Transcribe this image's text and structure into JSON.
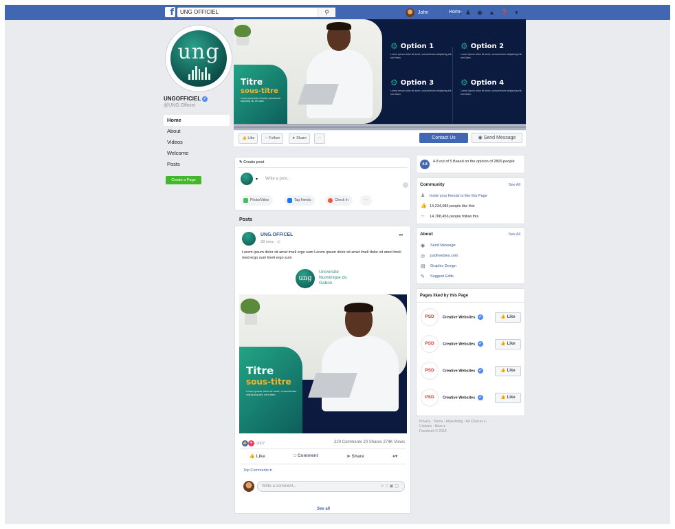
{
  "topbar": {
    "logo": "f",
    "search_value": "UNG OFFICIEL",
    "search_icon": "search-icon",
    "user_name": "John",
    "home_label": "Home",
    "icons": [
      "friends-icon",
      "messenger-icon",
      "notifications-icon",
      "help-icon",
      "caret-down-icon"
    ]
  },
  "profile": {
    "logo_text": "ung",
    "name": "UNGOFFICIEL",
    "handle": "@UNG.Officiel",
    "nav": [
      "Home",
      "About",
      "Videos",
      "Welcome",
      "Posts"
    ],
    "create_page": "Create a Page"
  },
  "cover": {
    "titre": "Titre",
    "sous_titre": "sous-titre",
    "lorem": "Lorem ipsum dolor sit amet, consectetuer adipiscing elit, sed diam.",
    "options": [
      {
        "title": "Option 1",
        "desc": "Lorem ipsum dolor sit amet, consectetuer adipiscing elit, sed diam."
      },
      {
        "title": "Option 2",
        "desc": "Lorem ipsum dolor sit amet, consectetuer adipiscing elit, sed diam."
      },
      {
        "title": "Option 3",
        "desc": "Lorem ipsum dolor sit amet, consectetuer adipiscing elit, sed diam."
      },
      {
        "title": "Option 4",
        "desc": "Lorem ipsum dolor sit amet, consectetuer adipiscing elit, sed diam."
      }
    ]
  },
  "actions": {
    "like": "Like",
    "follow": "Follow",
    "share": "Share",
    "more": "···",
    "contact": "Contact Us",
    "send_message": "Send Message"
  },
  "create_post": {
    "header": "Create post",
    "placeholder": "Write a post...",
    "buttons": [
      "Photo/Video",
      "Tag friends",
      "Check In",
      "···"
    ]
  },
  "posts": {
    "label": "Posts",
    "author": "UNG.OFFICEL",
    "time": "38 mins ·",
    "text": "Lorem ipsum dolor sit amet lmeli ergo sum Lorem ipsum dolor sit amet lmeli dolor sit amet lmeli med ergo sum lmeli ergo sum",
    "brand_logo": "ung",
    "brand_lines": [
      "Université",
      "Numérique du",
      "Gabon"
    ],
    "image_titre": "Titre",
    "image_sous_titre": "sous-titre",
    "image_lorem": "Lorem ipsum dolor sit amet, consectetuer adipiscing elit, sed diam.",
    "reactions_count": "2007",
    "stats": "220 Comments  20 Shares  274K Views",
    "like": "Like",
    "comment": "Comment",
    "share": "Share",
    "top_comments": "Top Comments ▾",
    "comment_placeholder": "Write a comment...",
    "see_all": "See all"
  },
  "rating": {
    "value": "4.8",
    "text": "4.8 out of 5  Based  on the opinion of 2800 people"
  },
  "community": {
    "title": "Community",
    "see_all": "See All",
    "rows": [
      "Invite your friends to like this Page",
      "14,234,085 people like this",
      "14,788,456 people follow this"
    ]
  },
  "about": {
    "title": "About",
    "see_all": "See All",
    "rows": [
      "Send Message",
      "psdfreebies.com",
      "Graphic Design",
      "Suggest Edits"
    ]
  },
  "liked_pages": {
    "title": "Pages liked by this Page",
    "items": [
      {
        "logo": "PSD",
        "name": "Creative Websites",
        "button": "Like"
      },
      {
        "logo": "PSD",
        "name": "Creative Websites",
        "button": "Like"
      },
      {
        "logo": "PSD",
        "name": "Creative Websites",
        "button": "Like"
      },
      {
        "logo": "PSD",
        "name": "Creative Websites",
        "button": "Like"
      }
    ]
  },
  "footer": {
    "line1": "Privacy · Terms · Advertising · Ad Choices ▷",
    "line2": "Cookies · More ▾",
    "line3": "Facebook © 2018"
  }
}
